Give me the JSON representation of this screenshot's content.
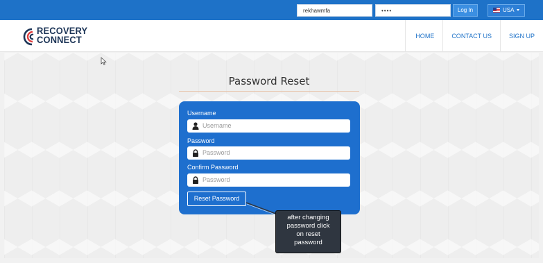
{
  "topbar": {
    "username_value": "rekhawmfa",
    "password_value": "••••",
    "login_label": "Log In",
    "country_label": "USA"
  },
  "header": {
    "logo_line1": "RECOVERY",
    "logo_line2": "CONNECT",
    "nav": [
      {
        "label": "HOME"
      },
      {
        "label": "CONTACT US"
      },
      {
        "label": "SIGN UP"
      }
    ]
  },
  "form": {
    "title": "Password Reset",
    "username_label": "Username",
    "username_placeholder": "Username",
    "password_label": "Password",
    "password_placeholder": "Password",
    "confirm_label": "Confirm Password",
    "confirm_placeholder": "Password",
    "reset_button": "Reset Password"
  },
  "tooltip": {
    "line1": "after changing",
    "line2": "password click",
    "line3": "on reset",
    "line4": "password"
  },
  "colors": {
    "topbar": "#1e72c8",
    "card": "#1e6fce",
    "nav_text": "#1e72c8",
    "tooltip_bg": "#2f3640"
  }
}
